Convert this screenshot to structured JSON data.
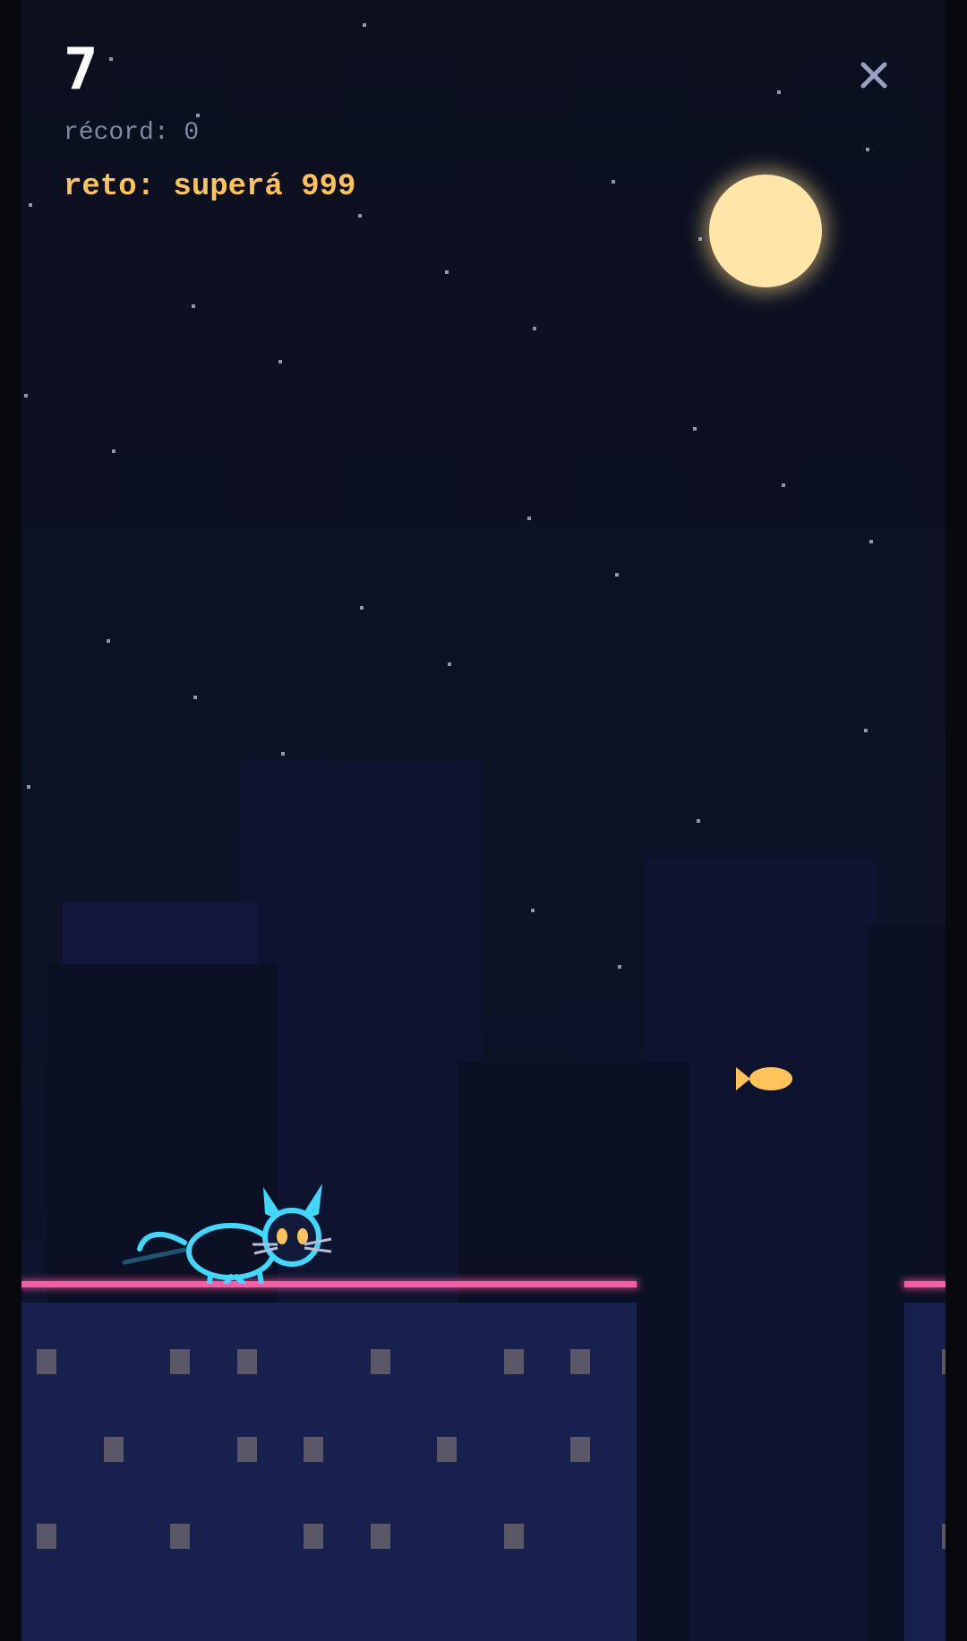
{
  "hud": {
    "score": "7",
    "record": "récord: 0",
    "challenge": "reto: superá 999"
  },
  "icons": {
    "close": "close-icon",
    "moon": "moon",
    "player": "cat-icon",
    "pickup": "fish-icon"
  },
  "colors": {
    "background": "#0b0f1e",
    "score": "#ffffff",
    "record": "#8088a3",
    "challenge": "#ffc35a",
    "moon": "#ffe6a8",
    "roof_neon": "#ff5aa3",
    "cat_neon": "#3fd8ff",
    "fish": "#ffc35a",
    "building_front": "#18204d"
  }
}
